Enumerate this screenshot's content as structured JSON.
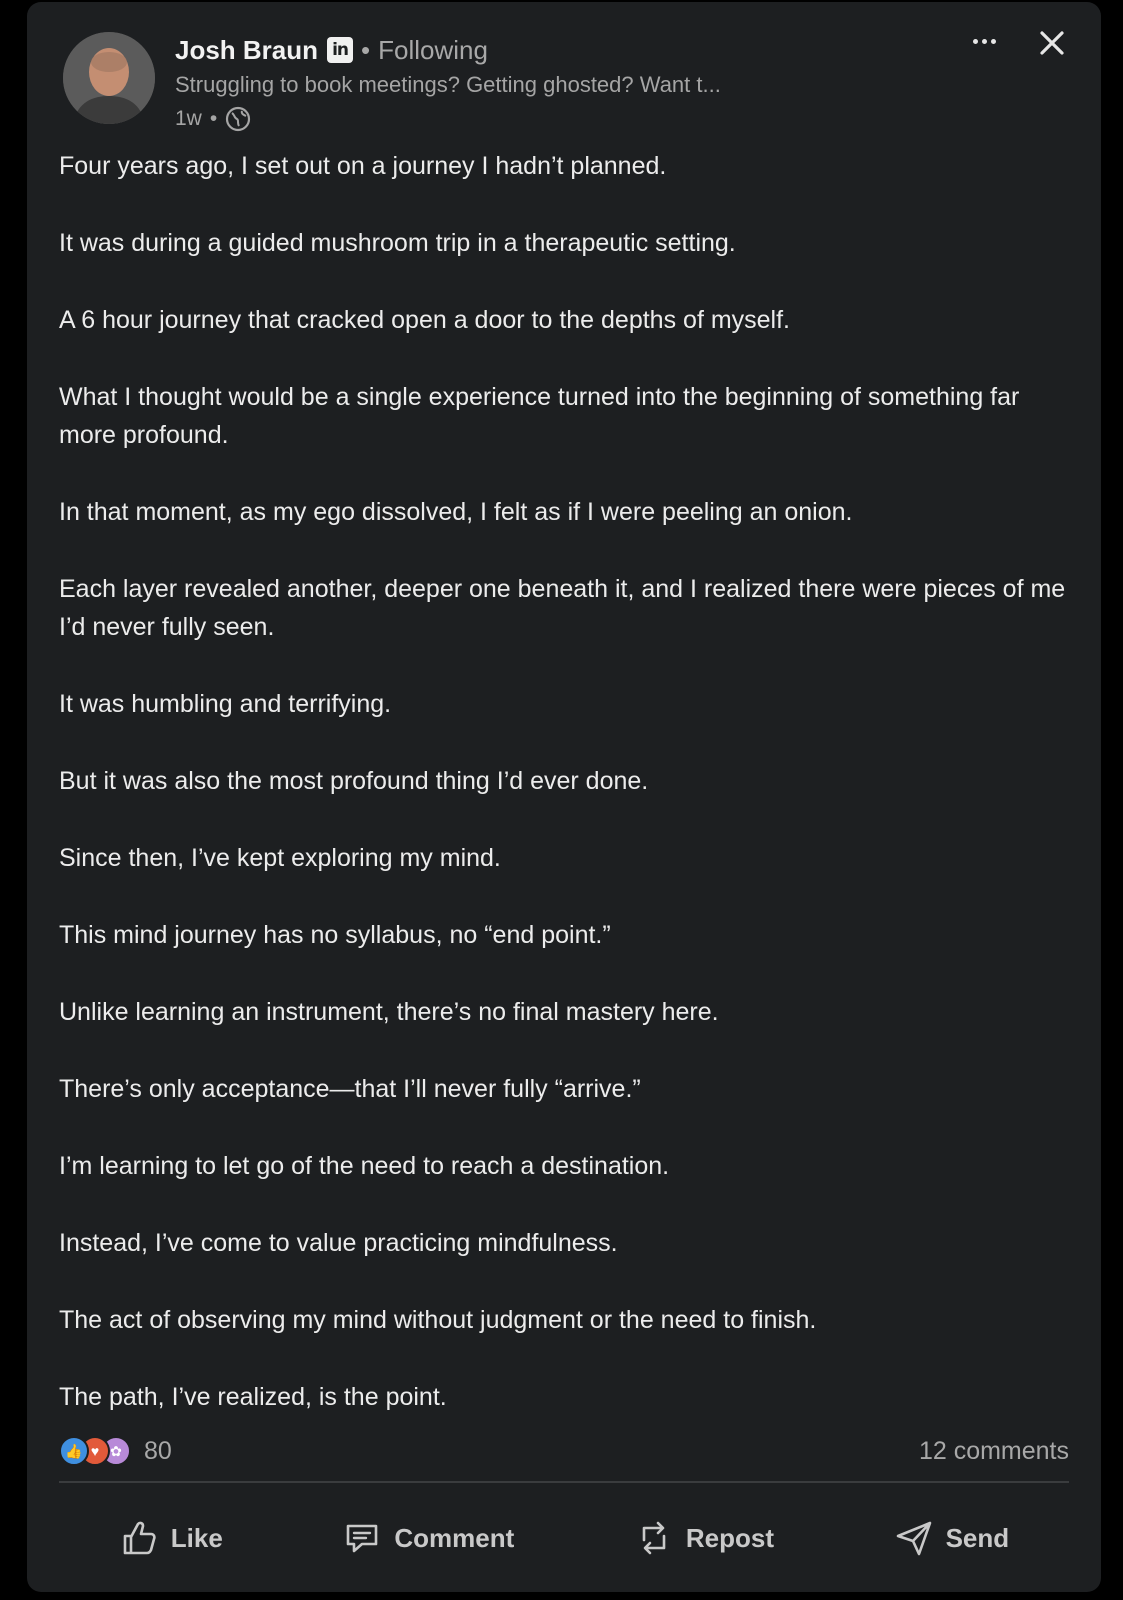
{
  "author": {
    "name": "Josh Braun",
    "network_badge": "in",
    "connection_status": "Following",
    "headline": "Struggling to book meetings? Getting ghosted? Want t...",
    "time": "1w",
    "visibility_icon": "globe-icon"
  },
  "post": {
    "paragraphs": [
      "Four years ago, I set out on a journey I hadn’t planned.",
      "It was during a guided mushroom trip in a therapeutic setting.",
      "A 6 hour journey that cracked open a door to the depths of myself.",
      "What I thought would be a single experience turned into the beginning of something far more profound.",
      "In that moment, as my ego dissolved, I felt as if I were peeling an onion.",
      "Each layer revealed another, deeper one beneath it, and I realized there were pieces of me I’d never fully seen.",
      "It was humbling and terrifying.",
      "But it was also the most profound thing I’d ever done.",
      "Since then, I’ve kept exploring my mind.",
      "This mind journey has no syllabus, no “end point.”",
      "Unlike learning an instrument, there’s no final mastery here.",
      "There’s only acceptance—that I’ll never fully “arrive.”",
      "I’m learning to let go of the need to reach a destination.",
      "Instead, I’ve come to value practicing mindfulness.",
      "The act of observing my mind without judgment or the need to finish.",
      "The path, I’ve realized, is the point."
    ]
  },
  "stats": {
    "reaction_icons": [
      "like-reaction-icon",
      "love-reaction-icon",
      "support-reaction-icon"
    ],
    "reaction_count": "80",
    "comments": "12 comments"
  },
  "actions": {
    "like": "Like",
    "comment": "Comment",
    "repost": "Repost",
    "send": "Send"
  },
  "colors": {
    "background": "#000000",
    "card": "#1d1f21",
    "text": "#ececec",
    "muted": "#a8a8a8",
    "like_blue": "#3f8fe0",
    "love_red": "#e25a3a"
  }
}
